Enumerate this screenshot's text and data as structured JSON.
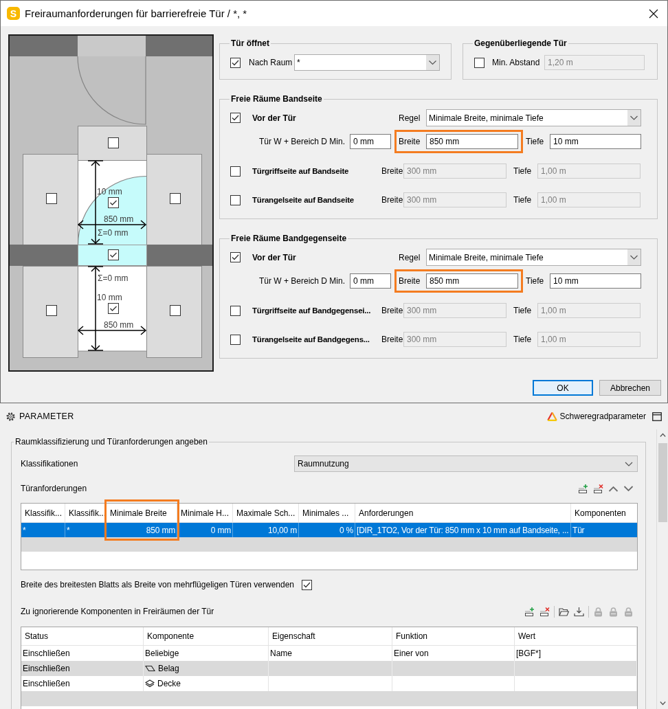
{
  "dialog": {
    "app_letter": "S",
    "title": "Freiraumanforderungen für barrierefreie Tür / *, *",
    "diagram": {
      "checkboxes": [
        {
          "checked": false
        },
        {
          "checked": false
        },
        {
          "checked": true
        },
        {
          "checked": false
        },
        {
          "checked": true
        },
        {
          "checked": false
        },
        {
          "checked": true
        },
        {
          "checked": false
        }
      ],
      "upper_zone": {
        "depth": "10 mm",
        "width": "850 mm",
        "sum": "Σ=0 mm"
      },
      "lower_zone": {
        "sum": "Σ=0 mm",
        "depth": "10 mm",
        "width": "850 mm"
      }
    },
    "door_opens": {
      "legend": "Tür öffnet",
      "label": "Nach Raum",
      "checked": true,
      "value": "*"
    },
    "opposite_door": {
      "legend": "Gegenüberliegende Tür",
      "label": "Min. Abstand",
      "checked": false,
      "value": "1,20 m",
      "disabled": true
    },
    "sections": [
      {
        "legend": "Freie Räume Bandseite",
        "front": {
          "label": "Vor der Tür",
          "checked": true,
          "rule_label": "Regel",
          "rule": "Minimale Breite, minimale Tiefe",
          "extra_label": "Tür W + Bereich D Min.",
          "extra": "0 mm",
          "width_label": "Breite",
          "width": "850 mm",
          "width_highlighted": true,
          "depth_label": "Tiefe",
          "depth": "10 mm"
        },
        "sides": [
          {
            "label": "Türgriffseite auf Bandseite",
            "checked": false,
            "width_label": "Breite",
            "width": "300 mm",
            "depth_label": "Tiefe",
            "depth": "1,00 m",
            "disabled": true
          },
          {
            "label": "Türangelseite auf Bandseite",
            "checked": false,
            "width_label": "Breite",
            "width": "300 mm",
            "depth_label": "Tiefe",
            "depth": "1,00 m",
            "disabled": true
          }
        ]
      },
      {
        "legend": "Freie Räume Bandgegenseite",
        "front": {
          "label": "Vor der Tür",
          "checked": true,
          "rule_label": "Regel",
          "rule": "Minimale Breite, minimale Tiefe",
          "extra_label": "Tür W + Bereich D Min.",
          "extra": "0 mm",
          "width_label": "Breite",
          "width": "850 mm",
          "width_highlighted": true,
          "depth_label": "Tiefe",
          "depth": "10 mm"
        },
        "sides": [
          {
            "label": "Türgriffseite auf Bandgegensei...",
            "checked": false,
            "width_label": "Breite",
            "width": "300 mm",
            "depth_label": "Tiefe",
            "depth": "1,00 m",
            "disabled": true
          },
          {
            "label": "Türangelseite auf Bandgegens...",
            "checked": false,
            "width_label": "Breite",
            "width": "300 mm",
            "depth_label": "Tiefe",
            "depth": "1,00 m",
            "disabled": true
          }
        ]
      }
    ],
    "buttons": [
      {
        "label": "OK",
        "default": true
      },
      {
        "label": "Abbrechen",
        "default": false
      }
    ]
  },
  "parameters": {
    "title": "PARAMETER",
    "severity_label": "Schweregradparameter",
    "group": {
      "legend": "Raumklassifizierung und Türanforderungen angeben",
      "classification_label": "Klassifikationen",
      "classification": "Raumnutzung",
      "requirements_label": "Türanforderungen",
      "requirements_toolbar": [
        [
          {
            "kind": "add",
            "disabled": false
          },
          {
            "kind": "delete",
            "disabled": false
          },
          {
            "kind": "up",
            "disabled": false
          },
          {
            "kind": "down",
            "disabled": false
          }
        ]
      ],
      "requirements_table": {
        "columns": [
          {
            "label": "Klassifik...",
            "highlighted": false
          },
          {
            "label": "Klassifik...",
            "highlighted": false
          },
          {
            "label": "Minimale Breite",
            "highlighted": true
          },
          {
            "label": "Minimale H...",
            "highlighted": false
          },
          {
            "label": "Maximale Sch...",
            "highlighted": false
          },
          {
            "label": "Minimales ...",
            "highlighted": false
          },
          {
            "label": "Anforderungen",
            "highlighted": false
          },
          {
            "label": "Komponenten",
            "highlighted": false
          }
        ],
        "rows": [
          {
            "selected": true,
            "cells": [
              "*",
              "*",
              "850 mm",
              "0 mm",
              "10,00 m",
              "0 %",
              "[DIR_1TO2, Vor der Tür: 850 mm x 10 mm auf Bandseite, ...",
              "Tür"
            ]
          }
        ]
      },
      "wide_leaf": {
        "label": "Breite des breitesten Blatts als Breite von mehrflügeligen Türen verwenden",
        "checked": true
      },
      "ignore_label": "Zu ignorierende Komponenten in Freiräumen der Tür",
      "ignore_toolbar": [
        [
          {
            "kind": "add",
            "disabled": false
          },
          {
            "kind": "delete",
            "disabled": false
          }
        ],
        [
          {
            "kind": "folder",
            "disabled": false
          },
          {
            "kind": "download",
            "disabled": false
          }
        ],
        [
          {
            "kind": "lock",
            "disabled": true
          },
          {
            "kind": "lock",
            "disabled": true
          },
          {
            "kind": "lock",
            "disabled": true
          }
        ]
      ],
      "ignore_table": {
        "columns": [
          "Status",
          "Komponente",
          "Eigenschaft",
          "Funktion",
          "Wert"
        ],
        "rows": [
          {
            "kind": "plain",
            "cells": [
              "Einschließen",
              "Beliebige",
              "Name",
              "Einer von",
              "[BGF*]"
            ]
          },
          {
            "kind": "covering",
            "cells": [
              "Einschließen",
              "Belag"
            ]
          },
          {
            "kind": "slab",
            "cells": [
              "Einschließen",
              "Decke"
            ]
          }
        ]
      }
    }
  }
}
